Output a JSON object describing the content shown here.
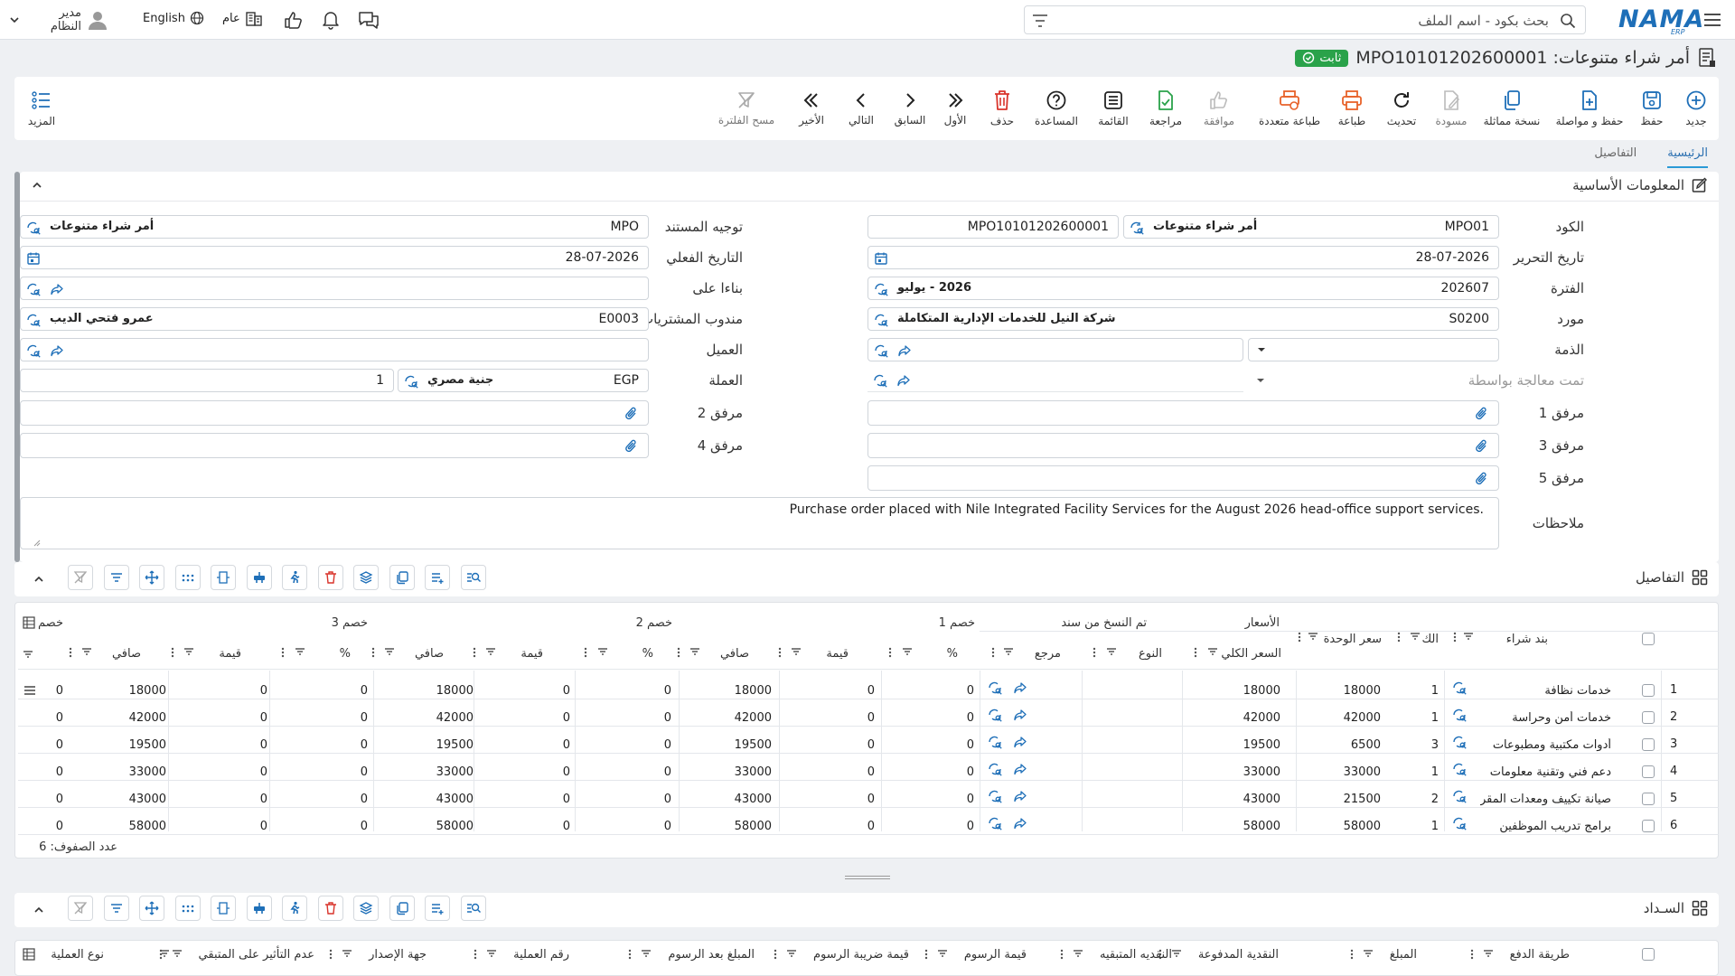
{
  "topbar": {
    "brand": "NAMA",
    "brand_sub": "ERP",
    "search_placeholder": "بحث بكود - اسم الملف",
    "language": "English",
    "public_label": "عام",
    "user": "مدير النظام"
  },
  "page": {
    "title": "أمر شراء متنوعات: MPO10101202600001",
    "status": "ثابت"
  },
  "toolbar": {
    "new": "جديد",
    "save": "حفظ",
    "save_continue": "حفظ و مواصلة",
    "copy_similar": "نسخة مماثلة",
    "draft": "مسودة",
    "refresh": "تحديث",
    "print": "طباعة",
    "multi_print": "طباعة متعددة",
    "approve": "موافقة",
    "review": "مراجعة",
    "list": "القائمة",
    "help": "المساعدة",
    "delete": "حذف",
    "first": "الأول",
    "previous": "السابق",
    "next": "التالي",
    "last": "الأخير",
    "clear_filter": "مسح الفلترة",
    "more": "المزيد"
  },
  "tabs": {
    "main": "الرئيسية",
    "details": "التفاصيل"
  },
  "basic": {
    "title": "المعلومات الأساسية",
    "labels": {
      "code": "الكود",
      "doc_direction": "توجيه المستند",
      "edit_date": "تاريخ التحرير",
      "actual_date": "التاريخ الفعلي",
      "period": "الفترة",
      "based_on": "بناءا على",
      "supplier": "مورد",
      "purchase_rep": "مندوب المشتريات",
      "liability": "الذمة",
      "customer": "العميل",
      "processed_by": "تمت معالجة بواسطة",
      "currency": "العملة",
      "attach1": "مرفق 1",
      "attach2": "مرفق 2",
      "attach3": "مرفق 3",
      "attach4": "مرفق 4",
      "attach5": "مرفق 5",
      "notes": "ملاحظات"
    },
    "values": {
      "code": "MPO01",
      "code_name": "أمر شراء متنوعات",
      "doc_number": "MPO10101202600001",
      "doc_dir_code": "MPO",
      "doc_dir_name": "أمر شراء متنوعات",
      "edit_date": "28-07-2026",
      "actual_date": "28-07-2026",
      "period_code": "202607",
      "period_name": "2026 - يوليو",
      "supplier_code": "S0200",
      "supplier_name": "شركة النيل للخدمات الإدارية المتكاملة",
      "rep_code": "E0003",
      "rep_name": "عمرو فتحي الديب",
      "currency_code": "EGP",
      "currency_name": "جنية مصري",
      "rate": "1",
      "notes": "Purchase order placed with Nile Integrated Facility Services for the August 2026 head-office support services."
    }
  },
  "details": {
    "title": "التفاصيل",
    "group_headers": {
      "prices": "الأسعار",
      "copied_from": "تم النسخ من سند",
      "disc1": "خصم 1",
      "disc2": "خصم 2",
      "disc3": "خصم 3",
      "disc_cut": "خصم"
    },
    "col_headers": {
      "item": "بند شراء",
      "qty": "الكمية",
      "unit_price": "سعر الوحدة",
      "total_price": "السعر الكلي",
      "type": "النوع",
      "ref": "مرجع",
      "pct": "%",
      "value": "قيمة",
      "net": "صافي"
    },
    "qty_short": "الك",
    "total_short": "السعر الكلي",
    "rows": [
      {
        "n": "1",
        "item": "خدمات نظافة",
        "qty": "1",
        "unit": "18000",
        "total": "18000",
        "d1p": "0",
        "d1v": "0",
        "d1n": "18000",
        "d2p": "0",
        "d2v": "0",
        "d2n": "18000",
        "d3p": "0",
        "d3v": "0",
        "d3n": "18000",
        "d4": "0"
      },
      {
        "n": "2",
        "item": "خدمات أمن وحراسة",
        "qty": "1",
        "unit": "42000",
        "total": "42000",
        "d1p": "0",
        "d1v": "0",
        "d1n": "42000",
        "d2p": "0",
        "d2v": "0",
        "d2n": "42000",
        "d3p": "0",
        "d3v": "0",
        "d3n": "42000",
        "d4": "0"
      },
      {
        "n": "3",
        "item": "أدوات مكتبية ومطبوعات",
        "qty": "3",
        "unit": "6500",
        "total": "19500",
        "d1p": "0",
        "d1v": "0",
        "d1n": "19500",
        "d2p": "0",
        "d2v": "0",
        "d2n": "19500",
        "d3p": "0",
        "d3v": "0",
        "d3n": "19500",
        "d4": "0"
      },
      {
        "n": "4",
        "item": "دعم فني وتقنية معلومات",
        "qty": "1",
        "unit": "33000",
        "total": "33000",
        "d1p": "0",
        "d1v": "0",
        "d1n": "33000",
        "d2p": "0",
        "d2v": "0",
        "d2n": "33000",
        "d3p": "0",
        "d3v": "0",
        "d3n": "33000",
        "d4": "0"
      },
      {
        "n": "5",
        "item": "صيانة تكييف ومعدات المقر",
        "qty": "2",
        "unit": "21500",
        "total": "43000",
        "d1p": "0",
        "d1v": "0",
        "d1n": "43000",
        "d2p": "0",
        "d2v": "0",
        "d2n": "43000",
        "d3p": "0",
        "d3v": "0",
        "d3n": "43000",
        "d4": "0"
      },
      {
        "n": "6",
        "item": "برامج تدريب الموظفين",
        "qty": "1",
        "unit": "58000",
        "total": "58000",
        "d1p": "0",
        "d1v": "0",
        "d1n": "58000",
        "d2p": "0",
        "d2v": "0",
        "d2n": "58000",
        "d3p": "0",
        "d3v": "0",
        "d3n": "58000",
        "d4": "0"
      }
    ],
    "row_count": "عدد الصفوف: 6"
  },
  "payment": {
    "title": "السـداد",
    "col_headers": {
      "method": "طريقة الدفع",
      "amount": "المبلغ",
      "paid_cash": "النقدية المدفوعة",
      "remaining_cash": "النقديه المتبقيه",
      "fee_value": "قيمة الرسوم",
      "fee_tax": "قيمة ضريبة الرسوم",
      "amount_after_fees": "المبلغ بعد الرسوم",
      "op_number": "رقم العملية",
      "issuer": "جهة الإصدار",
      "no_effect": "عدم التأثير على المتبقي",
      "op_type": "نوع العملية"
    }
  },
  "colors": {
    "accent": "#1e6fb8",
    "status_green": "#2aa24a",
    "delete_red": "#d9342b",
    "print_orange": "#e8622a"
  }
}
